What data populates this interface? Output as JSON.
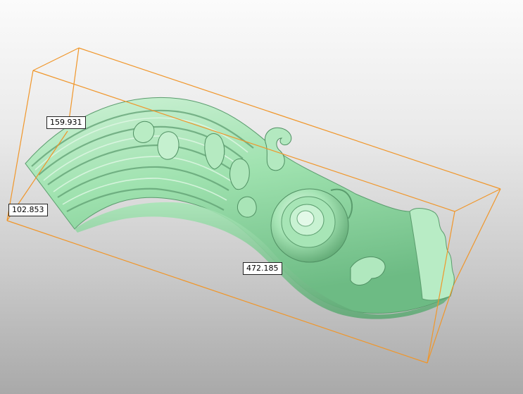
{
  "viewport": {
    "background_top": "#fbfbfb",
    "background_bottom": "#a9a9a9"
  },
  "model": {
    "color": "#9ee3ad",
    "shadow_color": "#5fae77",
    "highlight_color": "#dff7e4"
  },
  "bounding_box": {
    "color": "#f0962a"
  },
  "dimensions": {
    "height": "159.931",
    "depth": "102.853",
    "length": "472.185"
  }
}
